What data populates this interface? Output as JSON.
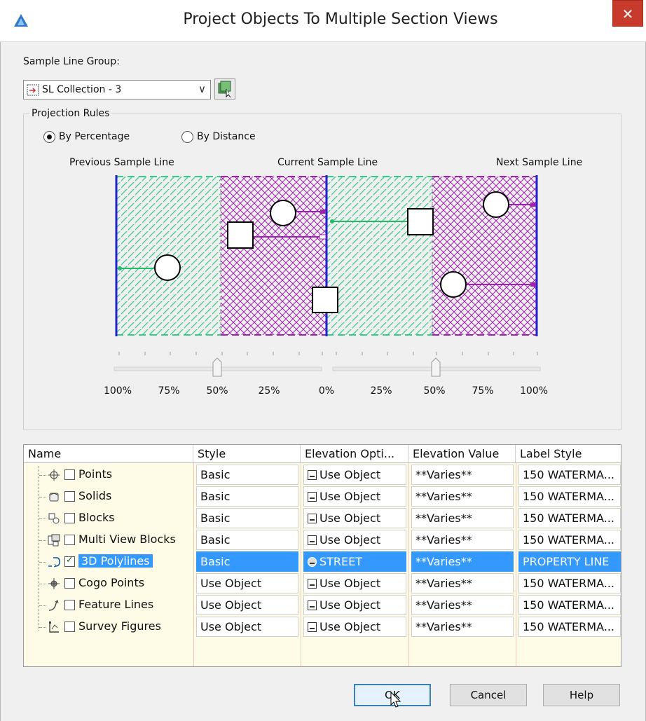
{
  "window": {
    "title": "Project Objects To Multiple Section Views",
    "close_glyph": "✕"
  },
  "sample_line_group": {
    "label": "Sample Line Group:",
    "selected": "SL Collection - 3",
    "dropdown_glyph": "∨"
  },
  "projection_rules": {
    "group_title": "Projection Rules",
    "by_percentage": "By Percentage",
    "by_distance": "By Distance",
    "selected": "by_percentage",
    "previous_label": "Previous Sample Line",
    "current_label": "Current Sample Line",
    "next_label": "Next Sample Line",
    "left_slider_pct": 50,
    "right_slider_pct": 50,
    "scale_labels": [
      "100%",
      "75%",
      "50%",
      "25%",
      "0%",
      "25%",
      "50%",
      "75%",
      "100%"
    ]
  },
  "grid": {
    "headers": [
      "Name",
      "Style",
      "Elevation Opti...",
      "Elevation Value",
      "Label Style"
    ],
    "rows": [
      {
        "name": "Points",
        "icon": "points-icon",
        "checked": false,
        "style": "Basic",
        "elevation_option": "Use Object",
        "elevation_value": "**Varies**",
        "label_style": "150 WATERMA..."
      },
      {
        "name": "Solids",
        "icon": "solids-icon",
        "checked": false,
        "style": "Basic",
        "elevation_option": "Use Object",
        "elevation_value": "**Varies**",
        "label_style": "150 WATERMA..."
      },
      {
        "name": "Blocks",
        "icon": "blocks-icon",
        "checked": false,
        "style": "Basic",
        "elevation_option": "Use Object",
        "elevation_value": "**Varies**",
        "label_style": "150 WATERMA..."
      },
      {
        "name": "Multi View Blocks",
        "icon": "multi-view-blocks-icon",
        "checked": false,
        "style": "Basic",
        "elevation_option": "Use Object",
        "elevation_value": "**Varies**",
        "label_style": "150 WATERMA..."
      },
      {
        "name": "3D Polylines",
        "icon": "3d-polyline-icon",
        "checked": true,
        "selected": true,
        "style": "Basic",
        "elevation_option": "STREET",
        "elevation_value": "**Varies**",
        "label_style": "PROPERTY LINE"
      },
      {
        "name": "Cogo Points",
        "icon": "cogo-points-icon",
        "checked": false,
        "style": "Use Object",
        "elevation_option": "Use Object",
        "elevation_value": "**Varies**",
        "label_style": "150 WATERMA..."
      },
      {
        "name": "Feature Lines",
        "icon": "feature-lines-icon",
        "checked": false,
        "style": "Use Object",
        "elevation_option": "Use Object",
        "elevation_value": "**Varies**",
        "label_style": "150 WATERMA..."
      },
      {
        "name": "Survey Figures",
        "icon": "survey-figures-icon",
        "checked": false,
        "style": "Use Object",
        "elevation_option": "Use Object",
        "elevation_value": "**Varies**",
        "label_style": "150 WATERMA..."
      }
    ]
  },
  "buttons": {
    "ok": "OK",
    "cancel": "Cancel",
    "help": "Help"
  },
  "colors": {
    "green_hatch": "#33cc88",
    "purple_hatch": "#a020b0",
    "sample_line": "#2222cc",
    "selection": "#3399ff",
    "grid_bg": "#fefbe6"
  }
}
